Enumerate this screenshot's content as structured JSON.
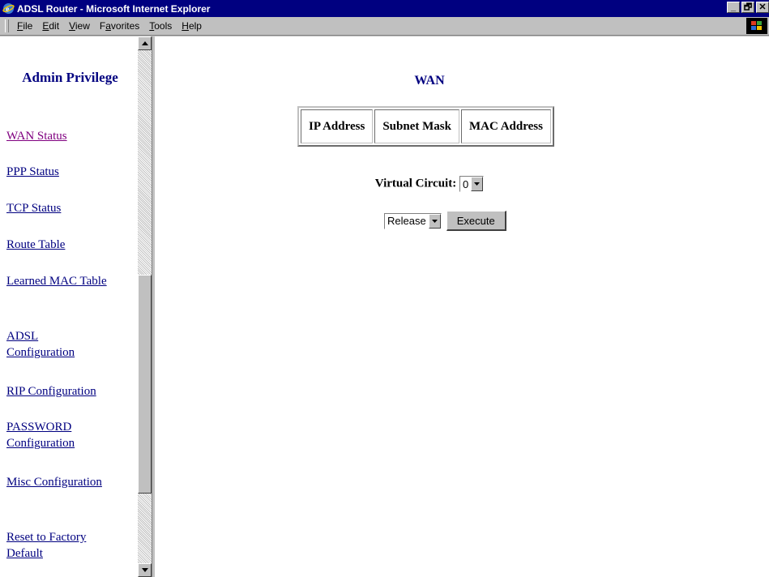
{
  "window": {
    "title": "ADSL Router - Microsoft Internet Explorer",
    "controls": [
      "_",
      "🗗",
      "✕"
    ]
  },
  "menu": {
    "items": [
      {
        "prefix": "",
        "accel": "F",
        "rest": "ile"
      },
      {
        "prefix": "",
        "accel": "E",
        "rest": "dit"
      },
      {
        "prefix": "",
        "accel": "V",
        "rest": "iew"
      },
      {
        "prefix": "F",
        "accel": "a",
        "rest": "vorites"
      },
      {
        "prefix": "",
        "accel": "T",
        "rest": "ools"
      },
      {
        "prefix": "",
        "accel": "H",
        "rest": "elp"
      }
    ]
  },
  "sidebar": {
    "title": "Admin Privilege",
    "links": [
      {
        "label": "WAN Status"
      },
      {
        "label": "PPP Status"
      },
      {
        "label": "TCP Status"
      },
      {
        "label": "Route Table"
      },
      {
        "label": "Learned MAC Table"
      },
      {
        "label": "ADSL Configuration"
      },
      {
        "label": "RIP Configuration"
      },
      {
        "label": "PASSWORD Configuration"
      },
      {
        "label": "Misc Configuration"
      },
      {
        "label": "Reset to Factory Default"
      }
    ]
  },
  "main": {
    "title": "WAN",
    "table_headers": [
      "IP Address",
      "Subnet Mask",
      "MAC Address"
    ],
    "virtual_circuit_label": "Virtual Circuit:",
    "virtual_circuit_value": "0",
    "action_value": "Release",
    "execute_label": "Execute"
  },
  "colors": {
    "titlebar": "#000080",
    "link": "#000080",
    "visited_link": "#800080",
    "chrome": "#c0c0c0"
  },
  "icons": {
    "titlebar": "ie-logo-icon",
    "menubar_right": "windows-logo-icon",
    "dropdown": "down-arrow-icon"
  }
}
